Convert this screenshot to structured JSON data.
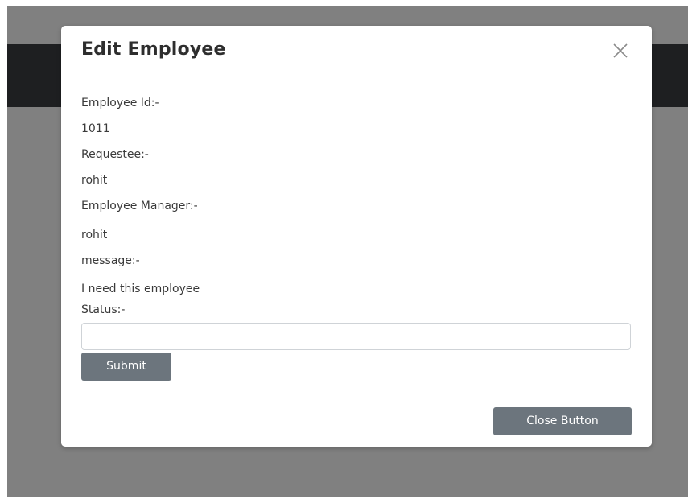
{
  "modal": {
    "title": "Edit Employee",
    "close_icon": "close-icon"
  },
  "fields": {
    "employee_id_label": "Employee Id:-",
    "employee_id_value": "1011",
    "requestee_label": "Requestee:-",
    "requestee_value": "rohit",
    "manager_label": "Employee Manager:-",
    "manager_value": "rohit",
    "message_label": "message:-",
    "message_value": "I need this employee",
    "status_label": "Status:-",
    "status_value": "",
    "status_placeholder": ""
  },
  "buttons": {
    "submit_label": "Submit",
    "close_label": "Close Button"
  },
  "colors": {
    "overlay": "#808080",
    "navbar": "#1e1f21",
    "button": "#6c757d"
  }
}
